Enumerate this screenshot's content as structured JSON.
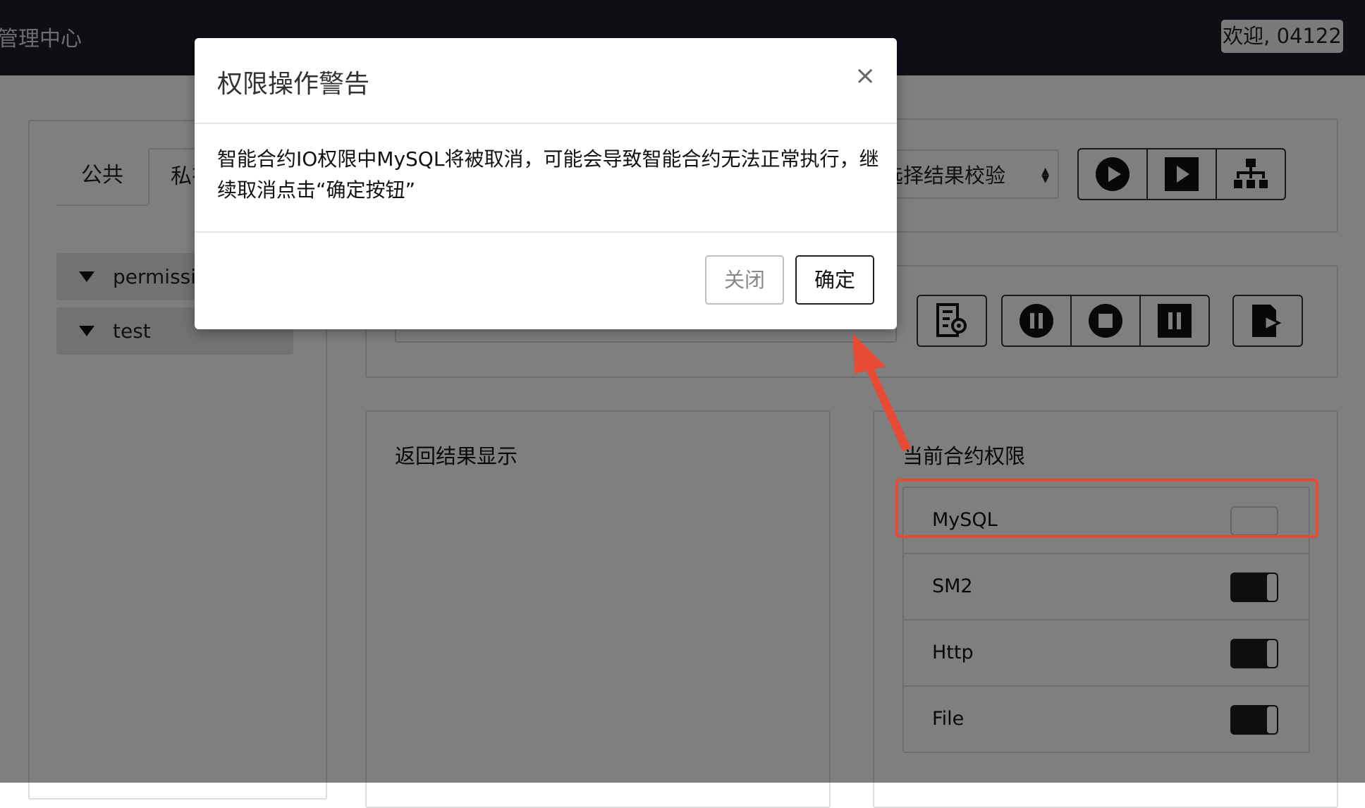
{
  "header": {
    "brand": "管理中心",
    "welcome": "欢迎, 04122"
  },
  "tabs": {
    "public": "公共",
    "private": "私有"
  },
  "tree": [
    {
      "label": "permission"
    },
    {
      "label": "test"
    }
  ],
  "toolbar": {
    "select_value": "选择结果校验"
  },
  "sections": {
    "result_title": "返回结果显示",
    "perm_title": "当前合约权限"
  },
  "permissions": [
    {
      "name": "MySQL",
      "enabled": false
    },
    {
      "name": "SM2",
      "enabled": true
    },
    {
      "name": "Http",
      "enabled": true
    },
    {
      "name": "File",
      "enabled": true
    }
  ],
  "modal": {
    "title": "权限操作警告",
    "close_symbol": "×",
    "message": "智能合约IO权限中MySQL将被取消，可能会导致智能合约无法正常执行，继续取消点击“确定按钮”",
    "cancel_label": "关闭",
    "confirm_label": "确定"
  },
  "colors": {
    "topbar": "#1b1f2b",
    "annotation": "#e94a34",
    "toggle_on": "#1c1c1c"
  }
}
